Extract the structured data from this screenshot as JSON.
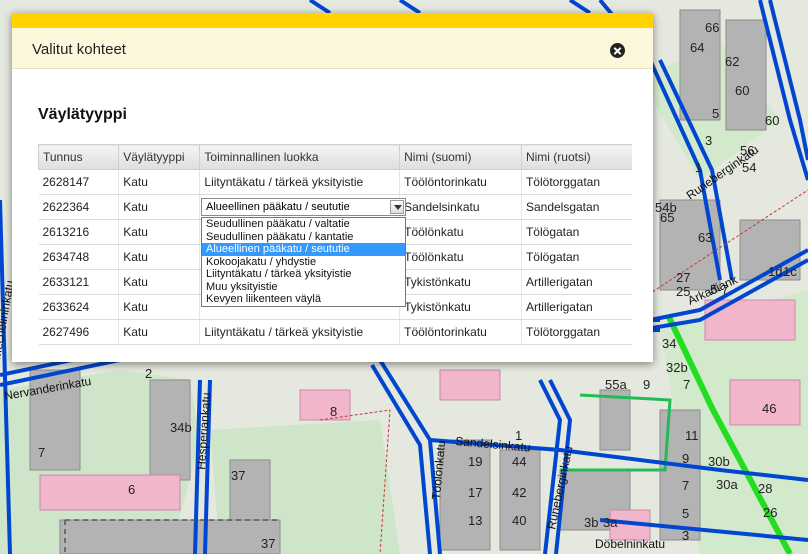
{
  "dialog": {
    "title": "Valitut kohteet",
    "section_title": "Väylätyyppi"
  },
  "table": {
    "columns": [
      "Tunnus",
      "Väylätyyppi",
      "Toiminnallinen luokka",
      "Nimi (suomi)",
      "Nimi (ruotsi)"
    ],
    "rows": [
      {
        "id": "2628147",
        "type": "Katu",
        "class": "Liityntäkatu / tärkeä yksityistie",
        "fi": "Töölöntorinkatu",
        "sv": "Tölötorggatan"
      },
      {
        "id": "2622364",
        "type": "Katu",
        "class": "",
        "fi": "Sandelsinkatu",
        "sv": "Sandelsgatan"
      },
      {
        "id": "2613216",
        "type": "Katu",
        "class": "",
        "fi": "Töölönkatu",
        "sv": "Tölögatan"
      },
      {
        "id": "2634748",
        "type": "Katu",
        "class": "",
        "fi": "Töölönkatu",
        "sv": "Tölögatan"
      },
      {
        "id": "2633121",
        "type": "Katu",
        "class": "",
        "fi": "Tykistönkatu",
        "sv": "Artillerigatan"
      },
      {
        "id": "2633624",
        "type": "Katu",
        "class": "",
        "fi": "Tykistönkatu",
        "sv": "Artillerigatan"
      },
      {
        "id": "2627496",
        "type": "Katu",
        "class": "Liityntäkatu / tärkeä yksityistie",
        "fi": "Töölöntorinkatu",
        "sv": "Tölötorggatan"
      }
    ]
  },
  "select": {
    "value": "Alueellinen pääkatu / seututie",
    "options": [
      "Seudullinen pääkatu / valtatie",
      "Seudullinen pääkatu / kantatie",
      "Alueellinen pääkatu / seututie",
      "Kokoojakatu / yhdystie",
      "Liityntäkatu / tärkeä yksityistie",
      "Muu yksityistie",
      "Kevyen liikenteen väylä"
    ],
    "selected_index": 2
  },
  "map": {
    "street_labels": [
      "Runebergink",
      "Runeberginkatu",
      "Sandelsinkatu",
      "Hesperiankatu",
      "Töölönkatu",
      "Döbelninkatu",
      "Arkadiank",
      "Mechelininkatu",
      "Nervanderinkatu"
    ],
    "numbers": [
      "66",
      "64",
      "62",
      "60",
      "58",
      "56",
      "54",
      "5",
      "3",
      "1",
      "54b",
      "65",
      "63",
      "27",
      "1d",
      "1c",
      "5-7",
      "25",
      "34",
      "32b",
      "2",
      "55a",
      "9",
      "7",
      "46",
      "8",
      "34b",
      "6",
      "37",
      "37",
      "11",
      "9",
      "7",
      "5",
      "3",
      "1",
      "44",
      "42",
      "40",
      "3b",
      "3a",
      "30b",
      "30a",
      "28",
      "26",
      "19",
      "17",
      "13",
      "7"
    ],
    "colors": {
      "street": "#0044cc",
      "selected": "#22cc22",
      "parks": "#cfe8c8",
      "buildings": "#a8a8a8",
      "pink": "#f0b8d0"
    }
  }
}
